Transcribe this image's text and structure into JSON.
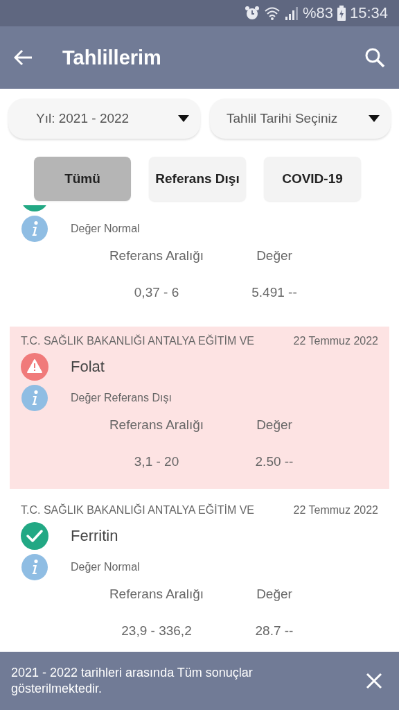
{
  "status_bar": {
    "battery": "%83",
    "time": "15:34"
  },
  "app_bar": {
    "title": "Tahlillerim"
  },
  "filters": [
    {
      "value": "Yıl: 2021 - 2022"
    },
    {
      "value": "Tahlil Tarihi Seçiniz"
    }
  ],
  "tabs": [
    {
      "label": "Tümü",
      "selected": true
    },
    {
      "label": "Referans Dışı",
      "selected": false
    },
    {
      "label": "COVID-19",
      "selected": false
    }
  ],
  "results": [
    {
      "kind": "normal",
      "info": "Değer Normal",
      "range_label": "Referans Aralığı",
      "value_label": "Değer",
      "range": "0,37 - 6",
      "value": "5.491 --"
    },
    {
      "institution": "T.C. SAĞLIK BAKANLIĞI ANTALYA EĞİTİM VE",
      "date": "22 Temmuz 2022",
      "kind": "out_of_range",
      "name": "Folat",
      "info": "Değer Referans Dışı",
      "range_label": "Referans Aralığı",
      "value_label": "Değer",
      "range": "3,1 - 20",
      "value": "2.50 --"
    },
    {
      "institution": "T.C. SAĞLIK BAKANLIĞI ANTALYA EĞİTİM VE",
      "date": "22 Temmuz 2022",
      "kind": "normal",
      "name": "Ferritin",
      "info": "Değer Normal",
      "range_label": "Referans Aralığı",
      "value_label": "Değer",
      "range": "23,9 - 336,2",
      "value": "28.7 --"
    }
  ],
  "snackbar": {
    "message": "2021 - 2022 tarihleri arasında Tüm sonuçlar gösterilmektedir."
  }
}
